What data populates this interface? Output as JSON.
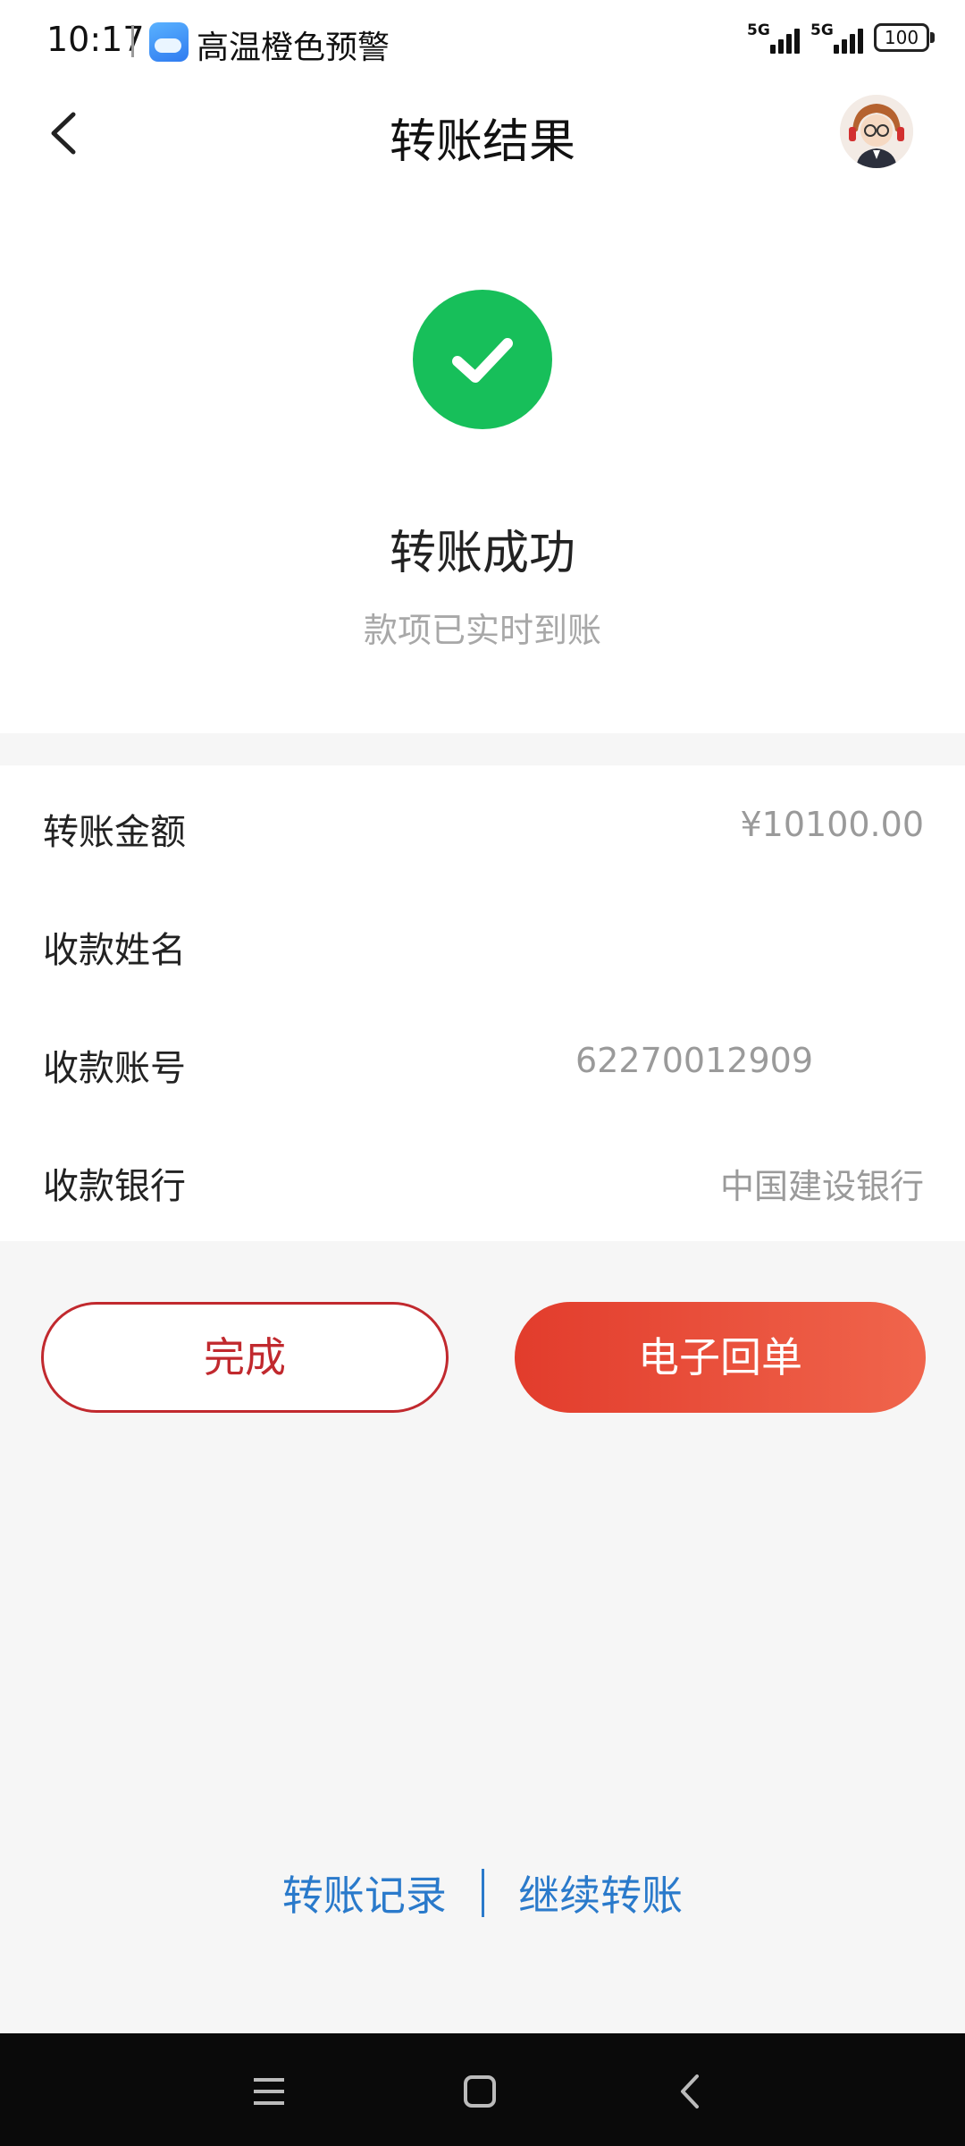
{
  "status_bar": {
    "time": "10:17",
    "alert_text": "高温橙色预警",
    "network_1": "5G",
    "network_2": "5G",
    "battery": "100",
    "icons": [
      "weather-icon",
      "signal-icon",
      "signal-icon",
      "battery-icon"
    ]
  },
  "header": {
    "title": "转账结果",
    "back_icon": "chevron-left-icon",
    "avatar_icon": "avatar-icon"
  },
  "result": {
    "icon": "check-circle-icon",
    "title": "转账成功",
    "subtitle": "款项已实时到账",
    "success_color": "#17bf5a"
  },
  "details": [
    {
      "label": "转账金额",
      "value": "¥10100.00"
    },
    {
      "label": "收款姓名",
      "value": ""
    },
    {
      "label": "收款账号",
      "value": "62270012909"
    },
    {
      "label": "收款银行",
      "value": "中国建设银行"
    }
  ],
  "actions": {
    "done_label": "完成",
    "receipt_label": "电子回单",
    "accent_color": "#e23c2c"
  },
  "footer": {
    "records_link": "转账记录",
    "continue_link": "继续转账",
    "link_color": "#2a7acb"
  },
  "nav": {
    "icons": [
      "menu-icon",
      "home-icon",
      "back-icon"
    ]
  }
}
